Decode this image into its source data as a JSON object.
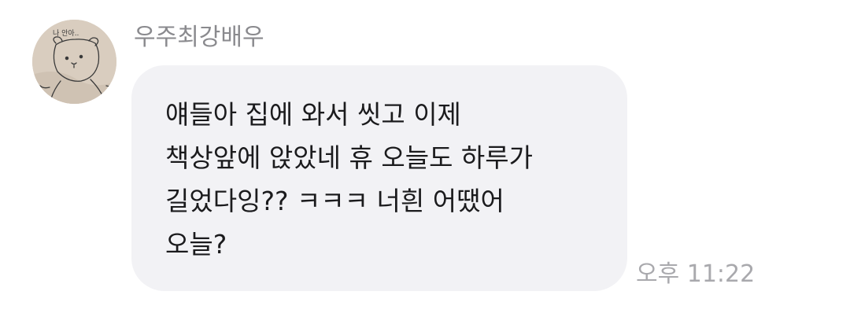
{
  "chat": {
    "sender": {
      "name": "우주최강배우",
      "avatar_icon": "bear-drawing-avatar",
      "avatar_caption": "나 안아.."
    },
    "message": {
      "lines": [
        "얘들아 집에 와서 씻고 이제",
        "책상앞에 앉았네 휴 오늘도 하루가",
        "길었다잉?? ㅋㅋㅋ 너흰 어땠어",
        "오늘?"
      ],
      "timestamp": "오후 11:22"
    }
  },
  "colors": {
    "bubble_background": "#f2f2f5",
    "message_text": "#1b1b1d",
    "sender_name": "#8a8a8e",
    "timestamp": "#a9a9ad",
    "avatar_background": "#d9cdbf"
  }
}
